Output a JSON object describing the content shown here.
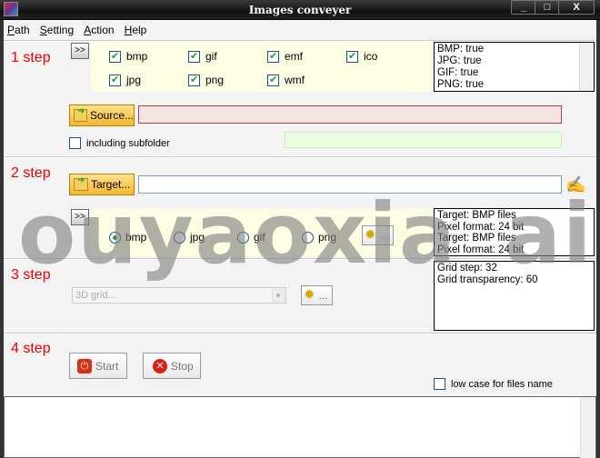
{
  "window": {
    "title": "Images conveyer",
    "minimize": "_",
    "maximize": "□",
    "close": "X"
  },
  "menu": [
    "Path",
    "Setting",
    "Action",
    "Help"
  ],
  "step1": {
    "label": "1 step",
    "expand": ">>",
    "formats": [
      {
        "name": "bmp",
        "checked": true
      },
      {
        "name": "gif",
        "checked": true
      },
      {
        "name": "emf",
        "checked": true
      },
      {
        "name": "ico",
        "checked": true
      },
      {
        "name": "jpg",
        "checked": true
      },
      {
        "name": "png",
        "checked": true
      },
      {
        "name": "wmf",
        "checked": true
      }
    ],
    "info": [
      "BMP: true",
      "JPG: true",
      "GIF: true",
      "PNG: true"
    ],
    "source_button": "Source...",
    "source_value": "",
    "subfolder_label": "including subfolder",
    "subfolder_checked": false
  },
  "step2": {
    "label": "2 step",
    "target_button": "Target...",
    "target_value": "",
    "expand": ">>",
    "formats": [
      {
        "name": "bmp",
        "selected": true
      },
      {
        "name": "jpg",
        "selected": false
      },
      {
        "name": "gif",
        "selected": false
      },
      {
        "name": "png",
        "selected": false
      }
    ],
    "settings_button": "...",
    "info": [
      "Target: BMP files",
      "Pixel format: 24 bit",
      "Target: BMP files",
      "Pixel format: 24 bit"
    ]
  },
  "step3": {
    "label": "3 step",
    "effect_placeholder": "3D grid...",
    "settings_button": "...",
    "info": [
      "Grid step: 32",
      "Grid transparency: 60"
    ]
  },
  "step4": {
    "label": "4 step",
    "start": "Start",
    "stop": "Stop",
    "lowcase_label": "low case for files name",
    "lowcase_checked": false
  },
  "log": "",
  "watermark": "ouyaoxia ai"
}
